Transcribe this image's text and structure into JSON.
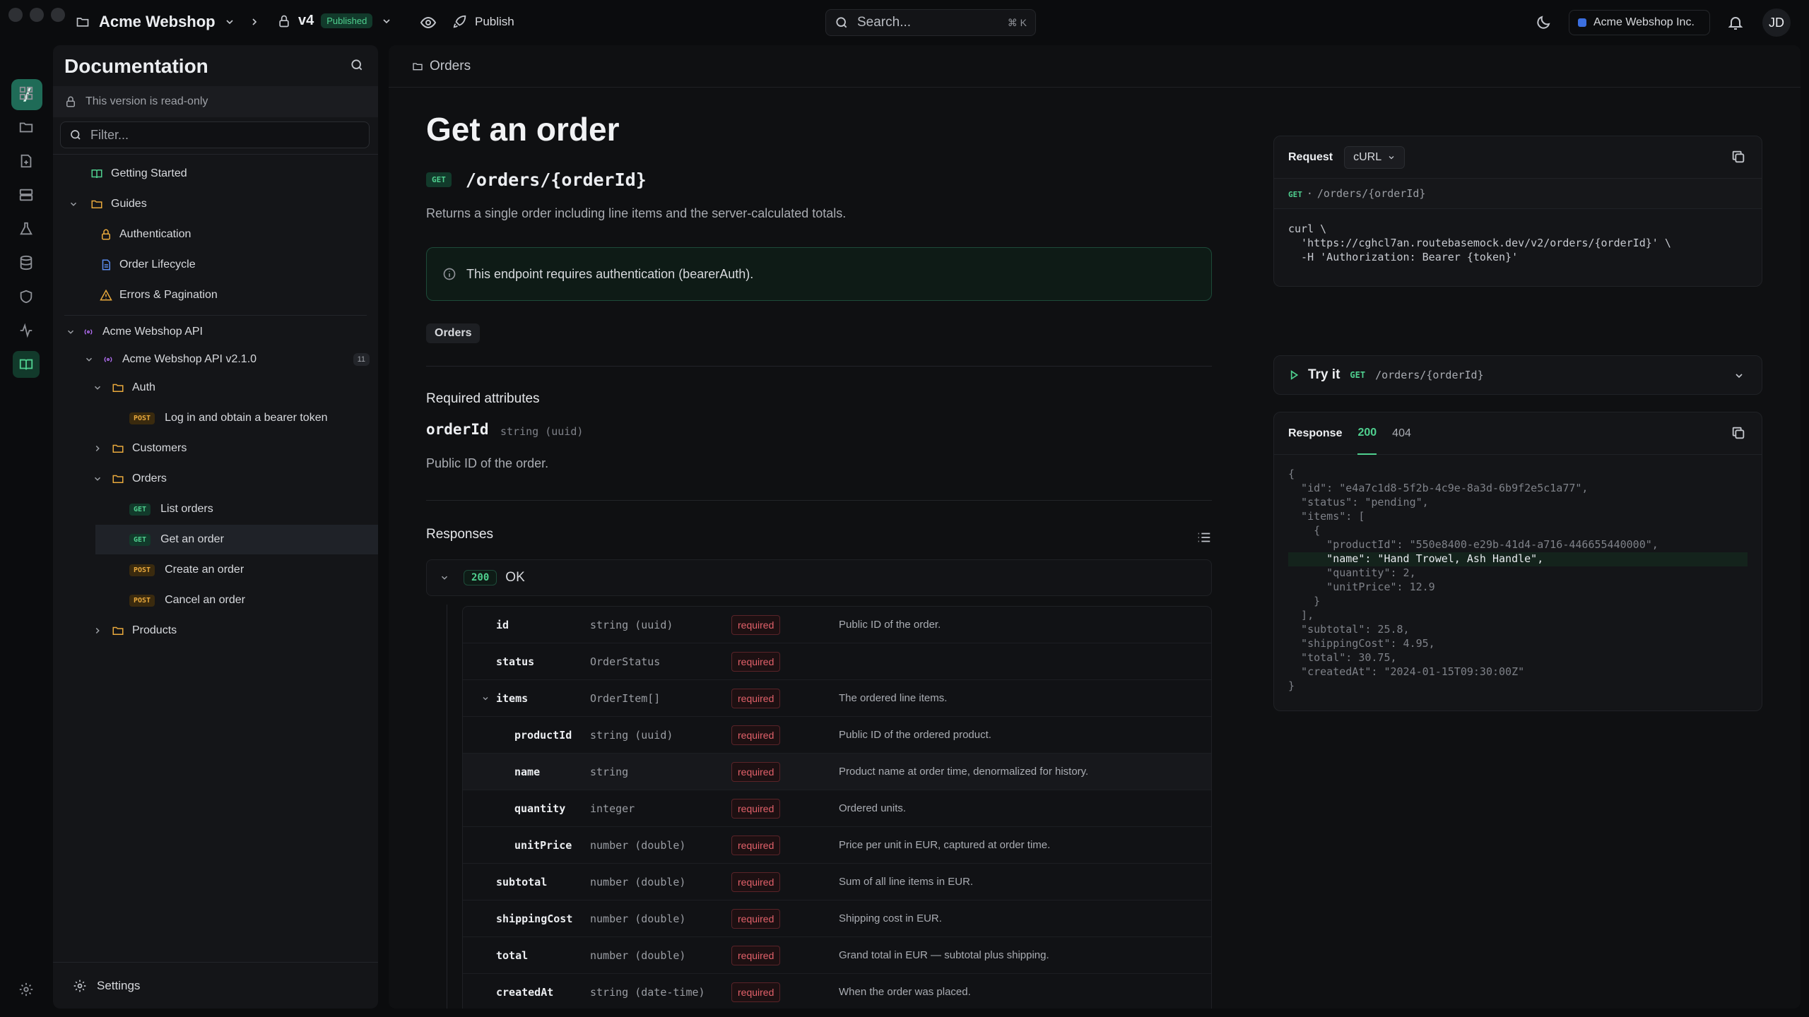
{
  "topbar": {
    "project": "Acme Webshop",
    "version": "v4",
    "version_status": "Published",
    "publish_label": "Publish",
    "search_placeholder": "Search...",
    "search_shortcut": "⌘ K",
    "org": "Acme Webshop Inc.",
    "avatar_initials": "JD"
  },
  "sidebar": {
    "title": "Documentation",
    "readonly_notice": "This version is read-only",
    "filter_placeholder": "Filter...",
    "items": {
      "getting_started": "Getting Started",
      "guides": "Guides",
      "authentication": "Authentication",
      "order_lifecycle": "Order Lifecycle",
      "errors": "Errors & Pagination",
      "api": "Acme Webshop API",
      "api_version": "Acme Webshop API v2.1.0",
      "api_count": "11",
      "auth": "Auth",
      "login": "Log in and obtain a bearer token",
      "customers": "Customers",
      "orders": "Orders",
      "list_orders": "List orders",
      "get_order": "Get an order",
      "create_order": "Create an order",
      "cancel_order": "Cancel an order",
      "products": "Products"
    },
    "methods": {
      "get": "GET",
      "post": "POST"
    },
    "settings": "Settings"
  },
  "main": {
    "breadcrumb": "Orders",
    "title": "Get an order",
    "method": "GET",
    "path": "/orders/{orderId}",
    "description": "Returns a single order including line items and the server-calculated totals.",
    "auth_notice": "This endpoint requires authentication (bearerAuth).",
    "tag": "Orders",
    "required_attributes": "Required attributes",
    "param_name": "orderId",
    "param_type": "string (uuid)",
    "param_desc": "Public ID of the order.",
    "responses_label": "Responses",
    "response_code": "200",
    "response_text": "OK",
    "required_label": "required",
    "fields": [
      {
        "name": "id",
        "type": "string (uuid)",
        "desc": "Public ID of the order."
      },
      {
        "name": "status",
        "type": "OrderStatus",
        "desc": ""
      },
      {
        "name": "items",
        "type": "OrderItem[]",
        "desc": "The ordered line items."
      },
      {
        "name": "productId",
        "type": "string (uuid)",
        "desc": "Public ID of the ordered product."
      },
      {
        "name": "name",
        "type": "string",
        "desc": "Product name at order time, denormalized for history."
      },
      {
        "name": "quantity",
        "type": "integer",
        "desc": "Ordered units."
      },
      {
        "name": "unitPrice",
        "type": "number (double)",
        "desc": "Price per unit in EUR, captured at order time."
      },
      {
        "name": "subtotal",
        "type": "number (double)",
        "desc": "Sum of all line items in EUR."
      },
      {
        "name": "shippingCost",
        "type": "number (double)",
        "desc": "Shipping cost in EUR."
      },
      {
        "name": "total",
        "type": "number (double)",
        "desc": "Grand total in EUR — subtotal plus shipping."
      },
      {
        "name": "createdAt",
        "type": "string (date-time)",
        "desc": "When the order was placed."
      }
    ]
  },
  "request": {
    "label": "Request",
    "lang": "cURL",
    "method": "GET",
    "path": "/orders/{orderId}",
    "code": "curl \\\n  'https://cghcl7an.routebasemock.dev/v2/orders/{orderId}' \\\n  -H 'Authorization: Bearer {token}'"
  },
  "tryit": {
    "label": "Try it",
    "method": "GET",
    "path": "/orders/{orderId}"
  },
  "response": {
    "label": "Response",
    "tabs": [
      "200",
      "404"
    ],
    "lines": [
      "{",
      "  \"id\": \"e4a7c1d8-5f2b-4c9e-8a3d-6b9f2e5c1a77\",",
      "  \"status\": \"pending\",",
      "  \"items\": [",
      "    {",
      "      \"productId\": \"550e8400-e29b-41d4-a716-446655440000\",",
      "      \"name\": \"Hand Trowel, Ash Handle\",",
      "      \"quantity\": 2,",
      "      \"unitPrice\": 12.9",
      "    }",
      "  ],",
      "  \"subtotal\": 25.8,",
      "  \"shippingCost\": 4.95,",
      "  \"total\": 30.75,",
      "  \"createdAt\": \"2024-01-15T09:30:00Z\"",
      "}"
    ]
  }
}
